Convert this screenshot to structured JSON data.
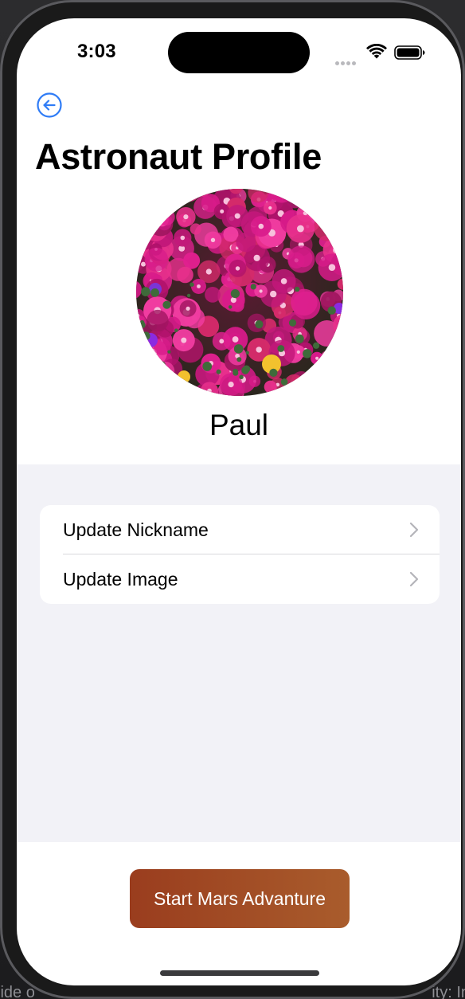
{
  "status_bar": {
    "time": "3:03"
  },
  "navigation": {
    "back_icon": "arrow-left-circle-icon",
    "title": "Astronaut Profile"
  },
  "profile": {
    "name": "Paul",
    "image_description_icon": "flower-photo"
  },
  "options": [
    {
      "label": "Update Nickname",
      "icon": "chevron-right-icon"
    },
    {
      "label": "Update Image",
      "icon": "chevron-right-icon"
    }
  ],
  "action": {
    "label": "Start Mars Advanture"
  },
  "background_text": {
    "left": "lide o",
    "right": "ity: In"
  },
  "colors": {
    "accent_blue": "#2f7cf6",
    "grouped_background": "#f2f2f7",
    "button_gradient_start": "#9a3d1e",
    "button_gradient_end": "#a95c2c"
  }
}
